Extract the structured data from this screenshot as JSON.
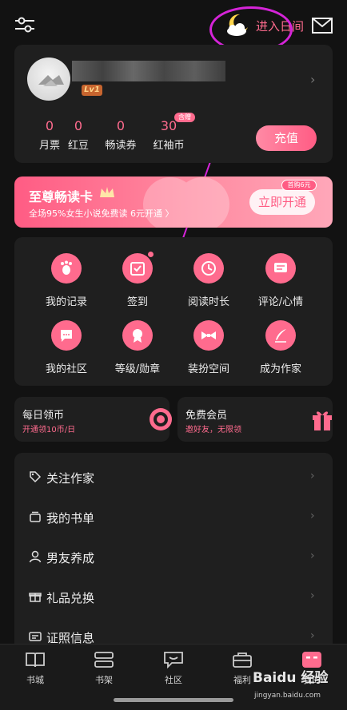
{
  "header": {
    "day_mode_label": "进入日间"
  },
  "profile": {
    "level_badge": "Lv1",
    "stats": [
      {
        "value": "0",
        "label": "月票"
      },
      {
        "value": "0",
        "label": "红豆"
      },
      {
        "value": "0",
        "label": "畅读券"
      },
      {
        "value": "30",
        "label": "红袖币"
      }
    ],
    "expire_tag": "含赠",
    "recharge_label": "充值"
  },
  "vip": {
    "title": "至尊畅读卡",
    "subtitle": "全场95%女生小说免费读 6元开通 〉",
    "first_tag": "首购6元",
    "button_label": "立即开通"
  },
  "grid": [
    {
      "label": "我的记录",
      "icon": "footprint-icon"
    },
    {
      "label": "签到",
      "icon": "checkin-icon"
    },
    {
      "label": "阅读时长",
      "icon": "clock-icon"
    },
    {
      "label": "评论/心情",
      "icon": "comment-icon"
    },
    {
      "label": "我的社区",
      "icon": "chat-icon"
    },
    {
      "label": "等级/勋章",
      "icon": "medal-icon"
    },
    {
      "label": "装扮空间",
      "icon": "bowtie-icon"
    },
    {
      "label": "成为作家",
      "icon": "quill-icon"
    }
  ],
  "coin_card": {
    "title": "每日领币",
    "subtitle": "开通领10币/日"
  },
  "member_card": {
    "title": "免费会员",
    "subtitle": "邀好友，无限领"
  },
  "menu": [
    {
      "label": "关注作家",
      "icon": "tag-icon"
    },
    {
      "label": "我的书单",
      "icon": "booklist-icon"
    },
    {
      "label": "男友养成",
      "icon": "user-icon"
    },
    {
      "label": "礼品兑换",
      "icon": "gift-icon"
    },
    {
      "label": "证照信息",
      "icon": "license-icon"
    }
  ],
  "tabs": [
    {
      "label": "书城",
      "icon": "book-icon"
    },
    {
      "label": "书架",
      "icon": "shelf-icon"
    },
    {
      "label": "社区",
      "icon": "community-icon"
    },
    {
      "label": "福利",
      "icon": "welfare-icon"
    },
    {
      "label": "我的",
      "icon": "me-icon"
    }
  ],
  "watermark": {
    "text": "Baidu 经验",
    "url": "jingyan.baidu.com"
  },
  "colors": {
    "accent": "#ff6b8e",
    "annotation": "#d524d8",
    "background": "#121212",
    "card": "#1f1f1f"
  }
}
